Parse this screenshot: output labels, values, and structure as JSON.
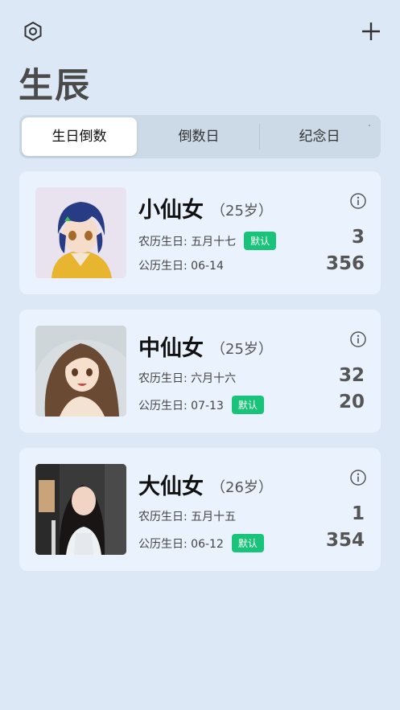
{
  "header": {
    "settings_icon": "settings-hexagon-icon",
    "add_icon": "plus-icon",
    "title": "生辰"
  },
  "tabs": [
    {
      "label": "生日倒数",
      "selected": true
    },
    {
      "label": "倒数日",
      "selected": false
    },
    {
      "label": "纪念日",
      "selected": false
    }
  ],
  "cards": [
    {
      "name": "小仙女",
      "age": "（25岁）",
      "lunar": "农历生日: 五月十七",
      "solar": "公历生日: 06-14",
      "lunar_badge": "默认",
      "count_top": "3",
      "count_bottom": "356"
    },
    {
      "name": "中仙女",
      "age": "（25岁）",
      "lunar": "农历生日: 六月十六",
      "solar": "公历生日: 07-13",
      "solar_badge": "默认",
      "count_top": "32",
      "count_bottom": "20"
    },
    {
      "name": "大仙女",
      "age": "（26岁）",
      "lunar": "农历生日: 五月十五",
      "solar": "公历生日: 06-12",
      "solar_badge": "默认",
      "count_top": "1",
      "count_bottom": "354"
    }
  ],
  "colors": {
    "background": "#dce8f5",
    "card": "#eaf3fd",
    "badge": "#19c37a"
  }
}
